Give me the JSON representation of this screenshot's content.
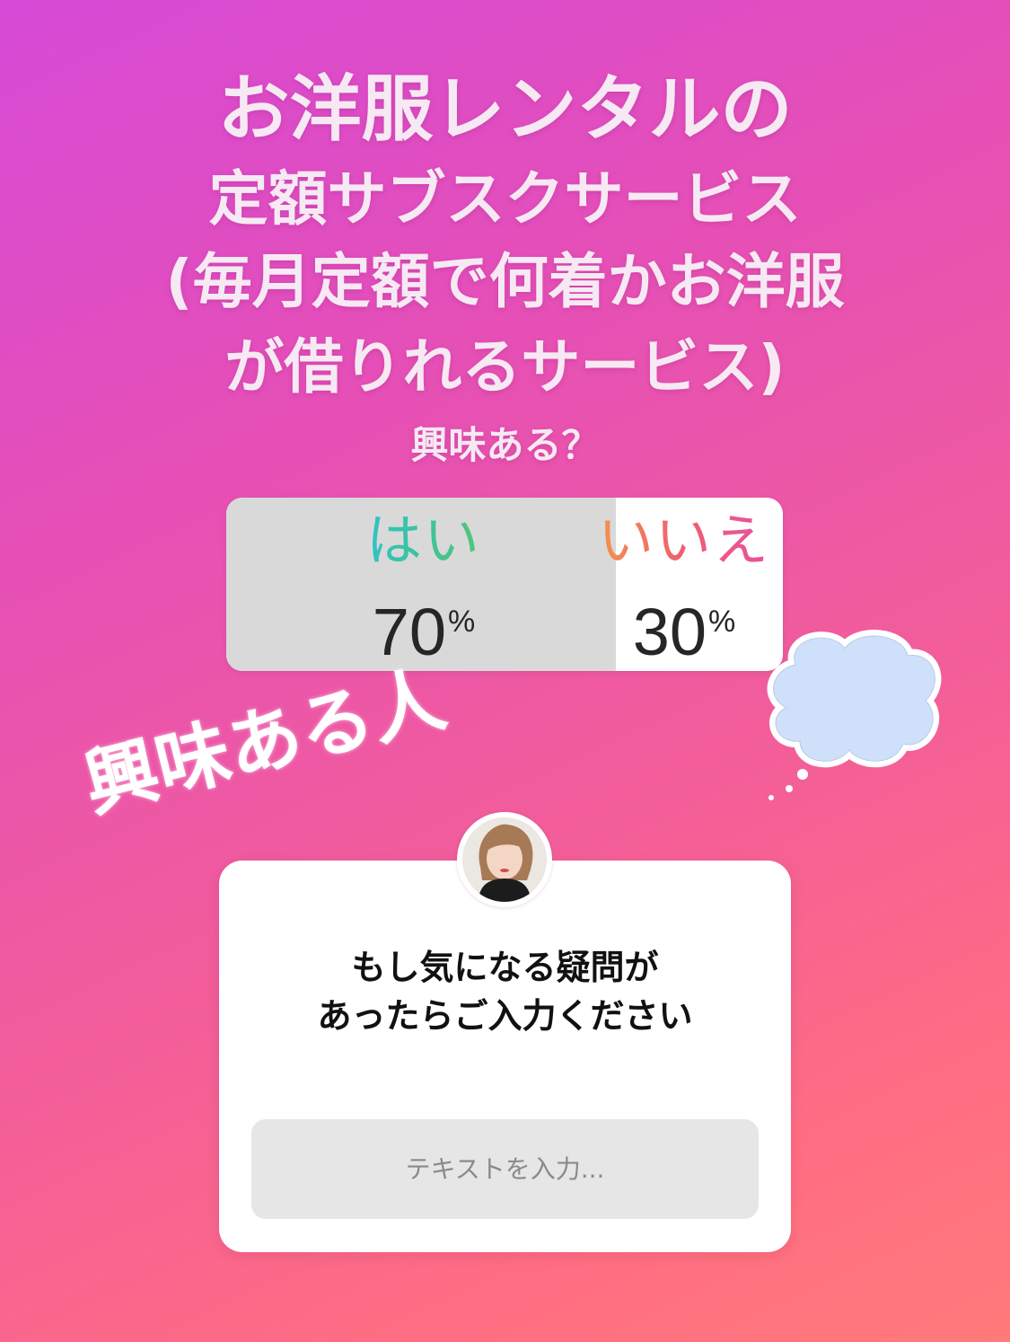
{
  "story": {
    "title_lines": [
      "お洋服レンタルの",
      "定額サブスクサービス",
      "(毎月定額で何着かお洋服",
      "が借りれるサービス)"
    ],
    "subtitle": "興味ある？"
  },
  "poll": {
    "options": [
      {
        "label": "はい",
        "percent": "70",
        "percent_sign": "%"
      },
      {
        "label": "いいえ",
        "percent": "30",
        "percent_sign": "%"
      }
    ],
    "yes_share": 0.7
  },
  "caption": "興味ある人",
  "question": {
    "lines": [
      "もし気になる疑問が",
      "あったらご入力ください"
    ],
    "input_placeholder": "テキストを入力..."
  },
  "decorations": {
    "cloud_icon": "thought-cloud-icon",
    "cloud_color": "#cfe0fb",
    "avatar_icon": "user-avatar-icon"
  }
}
